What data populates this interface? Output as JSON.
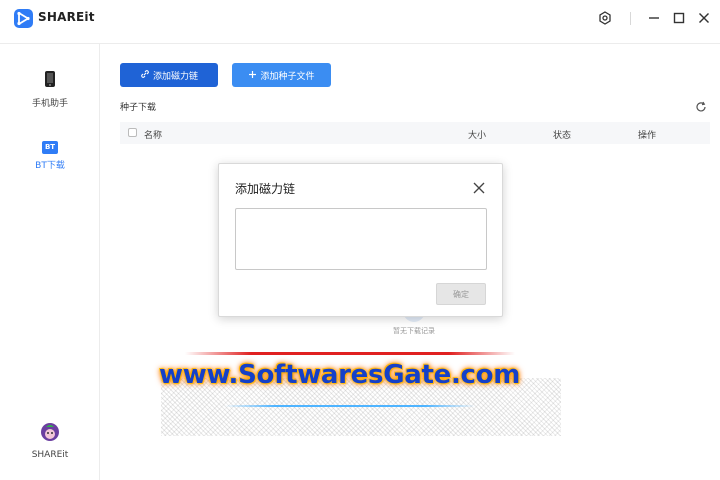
{
  "app": {
    "title": "SHAREit"
  },
  "sidebar": {
    "items": [
      {
        "label": "手机助手",
        "icon": "phone-icon"
      },
      {
        "label": "BT下载",
        "badge": "BT",
        "icon": "bt-icon",
        "active": true
      }
    ],
    "footer": {
      "label": "SHAREit",
      "icon": "shareit-avatar-icon"
    }
  },
  "toolbar": {
    "add_magnet_label": "添加磁力链",
    "add_seed_label": "添加种子文件"
  },
  "main": {
    "section_label": "种子下载",
    "table": {
      "columns": [
        "名称",
        "大小",
        "状态",
        "操作"
      ]
    },
    "empty_text": "暂无下载记录"
  },
  "dialog": {
    "title": "添加磁力链",
    "textarea_value": "",
    "ok_label": "确定"
  },
  "watermark": {
    "text": "www.SoftwaresGate.com"
  },
  "colors": {
    "accent": "#2f7cf6",
    "button_dark": "#1f63d6",
    "button_light": "#3b8df2"
  }
}
